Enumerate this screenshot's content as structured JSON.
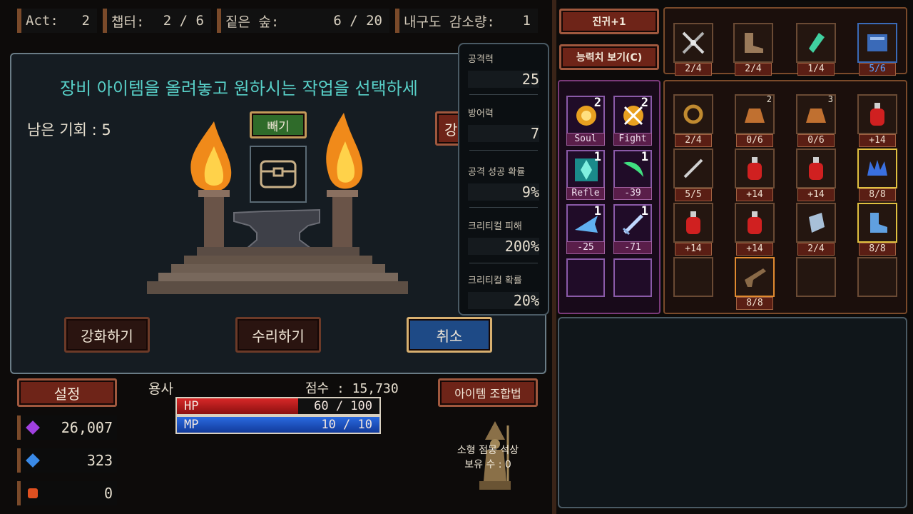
{
  "top_bar": {
    "act_label": "Act:",
    "act_value": "2",
    "chapter_label": "챕터:",
    "chapter_value": "2 / 6",
    "forest_label": "짙은 숲:",
    "forest_value": "6 / 20",
    "durability_label": "내구도 감소량:",
    "durability_value": "1"
  },
  "forge": {
    "title": "장비 아이템을 올려놓고 원하시는 작업을 선택하세",
    "remaining": "남은 기회 : 5",
    "remove_button": "빼기",
    "side_button": "강",
    "enhance_button": "강화하기",
    "repair_button": "수리하기",
    "cancel_button": "취소"
  },
  "stats_popup": {
    "items": [
      {
        "label": "공격력",
        "value": "25"
      },
      {
        "label": "방어력",
        "value": "7"
      },
      {
        "label": "공격 성공 확률",
        "value": "9%"
      },
      {
        "label": "크리티컬 피해",
        "value": "200%"
      },
      {
        "label": "크리티컬 확률",
        "value": "20%"
      }
    ]
  },
  "bottom": {
    "settings_button": "설정",
    "hero_name": "용사",
    "score": "점수 : 15,730",
    "hp_label": "HP",
    "hp_value": "60 / 100",
    "hp_ratio": 0.6,
    "mp_label": "MP",
    "mp_value": "10 / 10",
    "mp_ratio": 1.0,
    "recipe_button": "아이템 조합법",
    "currencies": [
      {
        "icon": "purple-gem-icon",
        "value": "26,007",
        "color": "#a040e0"
      },
      {
        "icon": "blue-gem-icon",
        "value": "323",
        "color": "#3a8ae8"
      },
      {
        "icon": "red-gem-icon",
        "value": "0",
        "color": "#e05020"
      }
    ],
    "statue_line1": "소형 점몽 석상",
    "statue_line2": "보유 수 : 0"
  },
  "right": {
    "promote_button": "진귀+1",
    "ability_button": "능력치 보기(C)",
    "equipped": [
      {
        "icon": "crossed-swords-icon",
        "label": "2/4",
        "blue": false
      },
      {
        "icon": "boots-icon",
        "label": "2/4",
        "blue": false
      },
      {
        "icon": "crystal-pendant-icon",
        "label": "1/4",
        "blue": false
      },
      {
        "icon": "spellbook-icon",
        "label": "5/6",
        "blue": true
      }
    ],
    "skills": [
      {
        "icon": "soul-skill-icon",
        "count": "2",
        "label": "Soul"
      },
      {
        "icon": "fight-skill-icon",
        "count": "2",
        "label": "Fight"
      },
      {
        "icon": "reflect-skill-icon",
        "count": "1",
        "label": "Refle"
      },
      {
        "icon": "green-slash-skill-icon",
        "count": "1",
        "label": "-39"
      },
      {
        "icon": "ice-wind-skill-icon",
        "count": "1",
        "label": "-25"
      },
      {
        "icon": "blade-skill-icon",
        "count": "1",
        "label": "-71"
      }
    ],
    "inventory": [
      {
        "icon": "whip-icon",
        "label": "2/4",
        "count": ""
      },
      {
        "icon": "pouch-icon",
        "label": "0/6",
        "count": "2"
      },
      {
        "icon": "pouch-icon",
        "label": "0/6",
        "count": "3"
      },
      {
        "icon": "red-potion-icon",
        "label": "+14",
        "count": ""
      },
      {
        "icon": "dagger-icon",
        "label": "5/5",
        "count": ""
      },
      {
        "icon": "red-potion-icon",
        "label": "+14",
        "count": ""
      },
      {
        "icon": "red-potion-icon",
        "label": "+14",
        "count": ""
      },
      {
        "icon": "blue-gauntlet-icon",
        "label": "8/8",
        "count": ""
      },
      {
        "icon": "red-potion-icon",
        "label": "+14",
        "count": ""
      },
      {
        "icon": "red-potion-icon",
        "label": "+14",
        "count": ""
      },
      {
        "icon": "iron-bracer-icon",
        "label": "2/4",
        "count": ""
      },
      {
        "icon": "blue-boots-icon",
        "label": "8/8",
        "count": ""
      },
      {
        "icon": "empty-slot",
        "label": "",
        "count": ""
      },
      {
        "icon": "flintlock-pistol-icon",
        "label": "8/8",
        "count": ""
      },
      {
        "icon": "empty-slot",
        "label": "",
        "count": ""
      },
      {
        "icon": "empty-slot",
        "label": "",
        "count": ""
      }
    ]
  }
}
